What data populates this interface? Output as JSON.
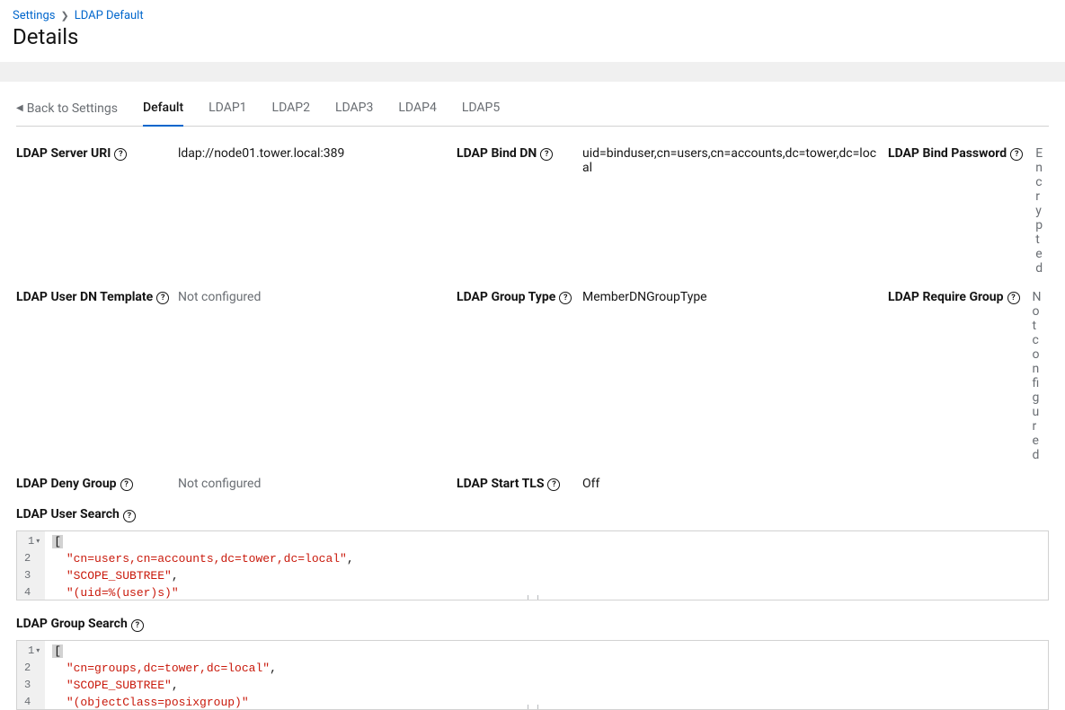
{
  "breadcrumb": {
    "root": "Settings",
    "current": "LDAP Default"
  },
  "page_title": "Details",
  "back_label": "Back to Settings",
  "tabs": [
    {
      "label": "Default",
      "active": true
    },
    {
      "label": "LDAP1",
      "active": false
    },
    {
      "label": "LDAP2",
      "active": false
    },
    {
      "label": "LDAP3",
      "active": false
    },
    {
      "label": "LDAP4",
      "active": false
    },
    {
      "label": "LDAP5",
      "active": false
    }
  ],
  "fields": {
    "server_uri": {
      "label": "LDAP Server URI",
      "value": "ldap://node01.tower.local:389",
      "muted": false
    },
    "bind_dn": {
      "label": "LDAP Bind DN",
      "value": "uid=binduser,cn=users,cn=accounts,dc=tower,dc=local",
      "muted": false
    },
    "bind_password": {
      "label": "LDAP Bind Password",
      "value": "Encrypted",
      "muted": true
    },
    "user_dn_template": {
      "label": "LDAP User DN Template",
      "value": "Not configured",
      "muted": true
    },
    "group_type": {
      "label": "LDAP Group Type",
      "value": "MemberDNGroupType",
      "muted": false
    },
    "require_group": {
      "label": "LDAP Require Group",
      "value": "Not configured",
      "muted": true
    },
    "deny_group": {
      "label": "LDAP Deny Group",
      "value": "Not configured",
      "muted": true
    },
    "start_tls": {
      "label": "LDAP Start TLS",
      "value": "Off",
      "muted": false
    }
  },
  "user_search": {
    "label": "LDAP User Search",
    "lines": [
      {
        "n": "1",
        "fold": true,
        "tokens": [
          {
            "t": "bracket",
            "v": "["
          }
        ]
      },
      {
        "n": "2",
        "fold": false,
        "tokens": [
          {
            "t": "plain",
            "v": "  "
          },
          {
            "t": "string",
            "v": "\"cn=users,cn=accounts,dc=tower,dc=local\""
          },
          {
            "t": "plain",
            "v": ","
          }
        ]
      },
      {
        "n": "3",
        "fold": false,
        "tokens": [
          {
            "t": "plain",
            "v": "  "
          },
          {
            "t": "string",
            "v": "\"SCOPE_SUBTREE\""
          },
          {
            "t": "plain",
            "v": ","
          }
        ]
      },
      {
        "n": "4",
        "fold": false,
        "tokens": [
          {
            "t": "plain",
            "v": "  "
          },
          {
            "t": "string",
            "v": "\"(uid=%(user)s)\""
          }
        ]
      }
    ]
  },
  "group_search": {
    "label": "LDAP Group Search",
    "lines": [
      {
        "n": "1",
        "fold": true,
        "tokens": [
          {
            "t": "bracket",
            "v": "["
          }
        ]
      },
      {
        "n": "2",
        "fold": false,
        "tokens": [
          {
            "t": "plain",
            "v": "  "
          },
          {
            "t": "string",
            "v": "\"cn=groups,dc=tower,dc=local\""
          },
          {
            "t": "plain",
            "v": ","
          }
        ]
      },
      {
        "n": "3",
        "fold": false,
        "tokens": [
          {
            "t": "plain",
            "v": "  "
          },
          {
            "t": "string",
            "v": "\"SCOPE_SUBTREE\""
          },
          {
            "t": "plain",
            "v": ","
          }
        ]
      },
      {
        "n": "4",
        "fold": false,
        "tokens": [
          {
            "t": "plain",
            "v": "  "
          },
          {
            "t": "string",
            "v": "\"(objectClass=posixgroup)\""
          }
        ]
      }
    ]
  }
}
